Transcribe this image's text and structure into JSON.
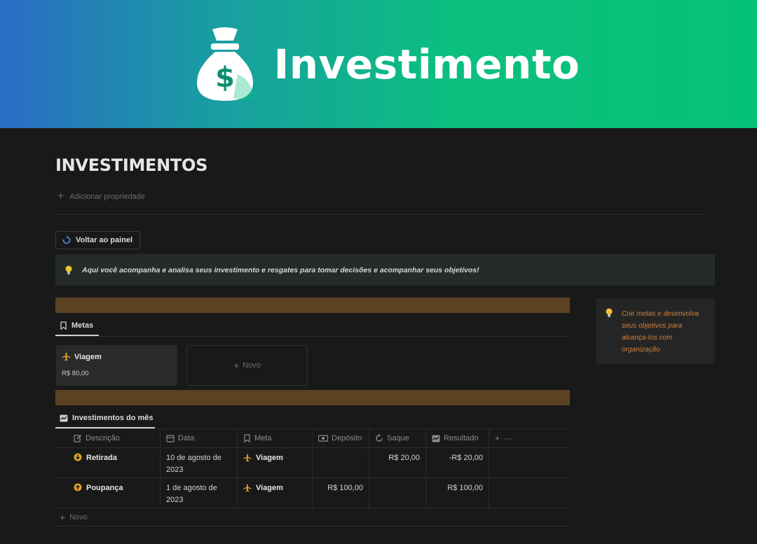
{
  "banner": {
    "title": "Investimento",
    "icon": "money-bag-icon"
  },
  "page": {
    "title": "INVESTIMENTOS",
    "add_property_label": "Adicionar propriedade"
  },
  "back_button": {
    "label": "Voltar ao painel",
    "icon": "refresh-icon"
  },
  "main_callout": {
    "icon": "lightbulb-icon",
    "text": "Aqui você acompanha e analisa seus investimento e resgates para tomar decisões e acompanhar seus objetivos!"
  },
  "side_callout": {
    "icon": "lightbulb-icon",
    "text": "Crie metas e desenvolva seus objetivos para alcança-los com organização"
  },
  "goals": {
    "tab_label": "Metas",
    "cards": [
      {
        "name": "Viagem",
        "amount": "R$ 80,00",
        "icon": "airplane-icon"
      }
    ],
    "new_label": "Novo"
  },
  "investments": {
    "tab_label": "Investimentos do mês",
    "columns": [
      {
        "label": "Descrição",
        "icon": "edit-icon"
      },
      {
        "label": "Data",
        "icon": "calendar-icon"
      },
      {
        "label": "Meta",
        "icon": "bookmark-icon"
      },
      {
        "label": "Depósito",
        "icon": "money-icon"
      },
      {
        "label": "Saque",
        "icon": "refresh-icon"
      },
      {
        "label": "Resultado",
        "icon": "table-icon"
      }
    ],
    "rows": [
      {
        "description": "Retirada",
        "icon": "arrow-down-circle-icon",
        "date": "10 de agosto de 2023",
        "goal": "Viagem",
        "deposit": "",
        "withdrawal": "R$ 20,00",
        "result": "-R$ 20,00"
      },
      {
        "description": "Poupança",
        "icon": "arrow-up-circle-icon",
        "date": "1 de agosto de 2023",
        "goal": "Viagem",
        "deposit": "R$ 100,00",
        "withdrawal": "",
        "result": "R$ 100,00"
      }
    ],
    "new_label": "Novo"
  },
  "colors": {
    "banner_start": "#2a6cc4",
    "banner_end": "#06c277",
    "brown_bar": "#5a4223",
    "accent_orange": "#d0823a",
    "icon_yellow": "#e0a526"
  }
}
